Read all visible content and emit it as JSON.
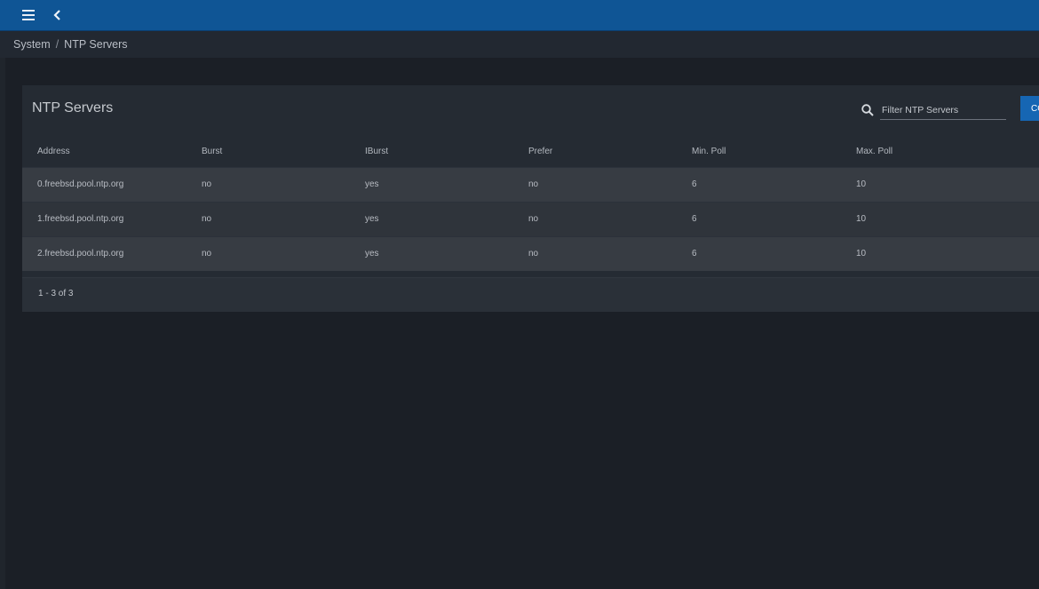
{
  "topbar": {
    "menu_icon": "hamburger-menu-icon",
    "back_icon": "chevron-left-icon",
    "color": "#0f5595"
  },
  "breadcrumb": {
    "parent": "System",
    "separator": "/",
    "current": "NTP Servers"
  },
  "card": {
    "title": "NTP Servers",
    "filter": {
      "placeholder": "Filter NTP Servers",
      "value": ""
    },
    "columns_button_label": "COLUMNS"
  },
  "table": {
    "headers": [
      "Address",
      "Burst",
      "IBurst",
      "Prefer",
      "Min. Poll",
      "Max. Poll"
    ],
    "rows": [
      [
        "0.freebsd.pool.ntp.org",
        "no",
        "yes",
        "no",
        "6",
        "10"
      ],
      [
        "1.freebsd.pool.ntp.org",
        "no",
        "yes",
        "no",
        "6",
        "10"
      ],
      [
        "2.freebsd.pool.ntp.org",
        "no",
        "yes",
        "no",
        "6",
        "10"
      ]
    ]
  },
  "pagination": {
    "range_text": "1 - 3 of 3"
  },
  "colors": {
    "accent": "#1666b3",
    "background": "#1b1f26",
    "card": "#252b33"
  }
}
